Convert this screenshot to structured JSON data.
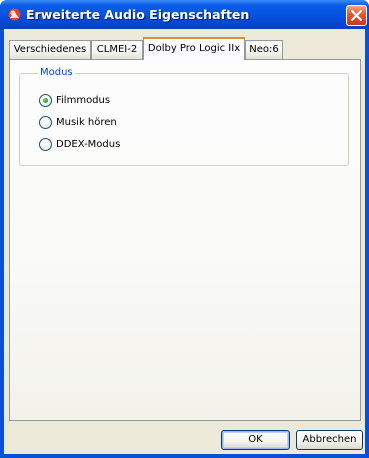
{
  "window": {
    "title": "Erweiterte Audio Eigenschaften",
    "icon": "app-icon",
    "close_icon": "close-icon"
  },
  "tabs": [
    {
      "label": "Verschiedenes",
      "active": false
    },
    {
      "label": "CLMEI-2",
      "active": false
    },
    {
      "label": "Dolby Pro Logic IIx",
      "active": true
    },
    {
      "label": "Neo:6",
      "active": false
    }
  ],
  "group": {
    "label": "Modus",
    "options": [
      {
        "label": "Filmmodus",
        "selected": true
      },
      {
        "label": "Musik hören",
        "selected": false
      },
      {
        "label": "DDEX-Modus",
        "selected": false
      }
    ]
  },
  "buttons": {
    "ok": "OK",
    "cancel": "Abbrechen"
  },
  "colors": {
    "titlebar": "#0553e0",
    "client": "#ece9d8",
    "active_tab_accent": "#e68b2c",
    "group_label": "#0046d5",
    "radio_dot": "#21a121",
    "close_button": "#e25a35"
  }
}
